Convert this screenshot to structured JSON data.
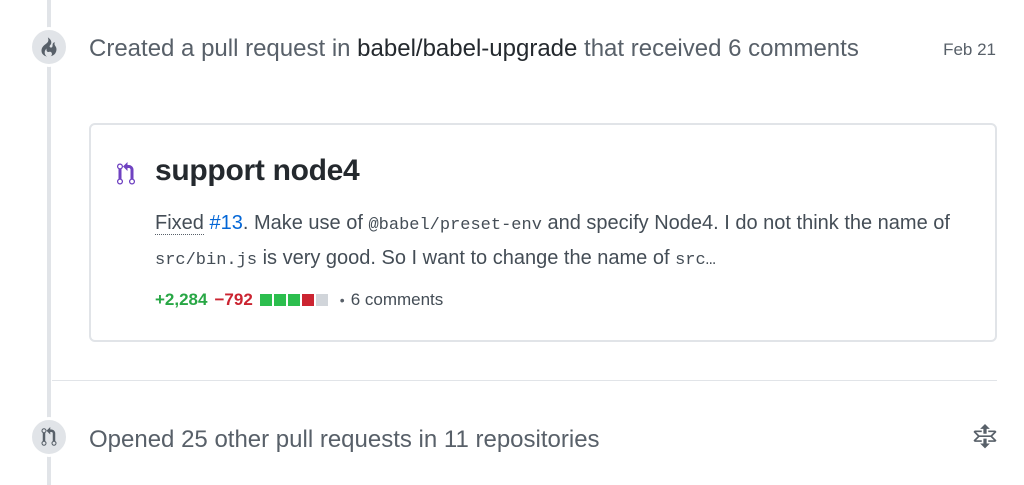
{
  "events": [
    {
      "icon": "flame-icon",
      "headline_prefix": "Created a pull request in",
      "repo": "babel/babel-upgrade",
      "headline_suffix": "that received 6 comments",
      "date": "Feb 21",
      "pull_request": {
        "icon": "git-pull-request-icon",
        "title": "support node4",
        "body": {
          "fixed_label": "Fixed",
          "issue_ref": "#13",
          "text1": ". Make use of",
          "code1": "@babel/preset-env",
          "text2": "and specify Node4. I do not think the name of",
          "code2": "src/bin.js",
          "text3": "is very good. So I want to change the name of",
          "code3": "src…"
        },
        "additions": "+2,284",
        "deletions": "−792",
        "diffstat_colors": [
          "#2cbe4e",
          "#2cbe4e",
          "#2cbe4e",
          "#cb2431",
          "#d1d5da"
        ],
        "separator": "•",
        "comments": "6 comments"
      }
    },
    {
      "icon": "git-pull-request-icon",
      "text": "Opened 25 other pull requests in 11 repositories",
      "action_icon": "unfold-icon"
    }
  ]
}
